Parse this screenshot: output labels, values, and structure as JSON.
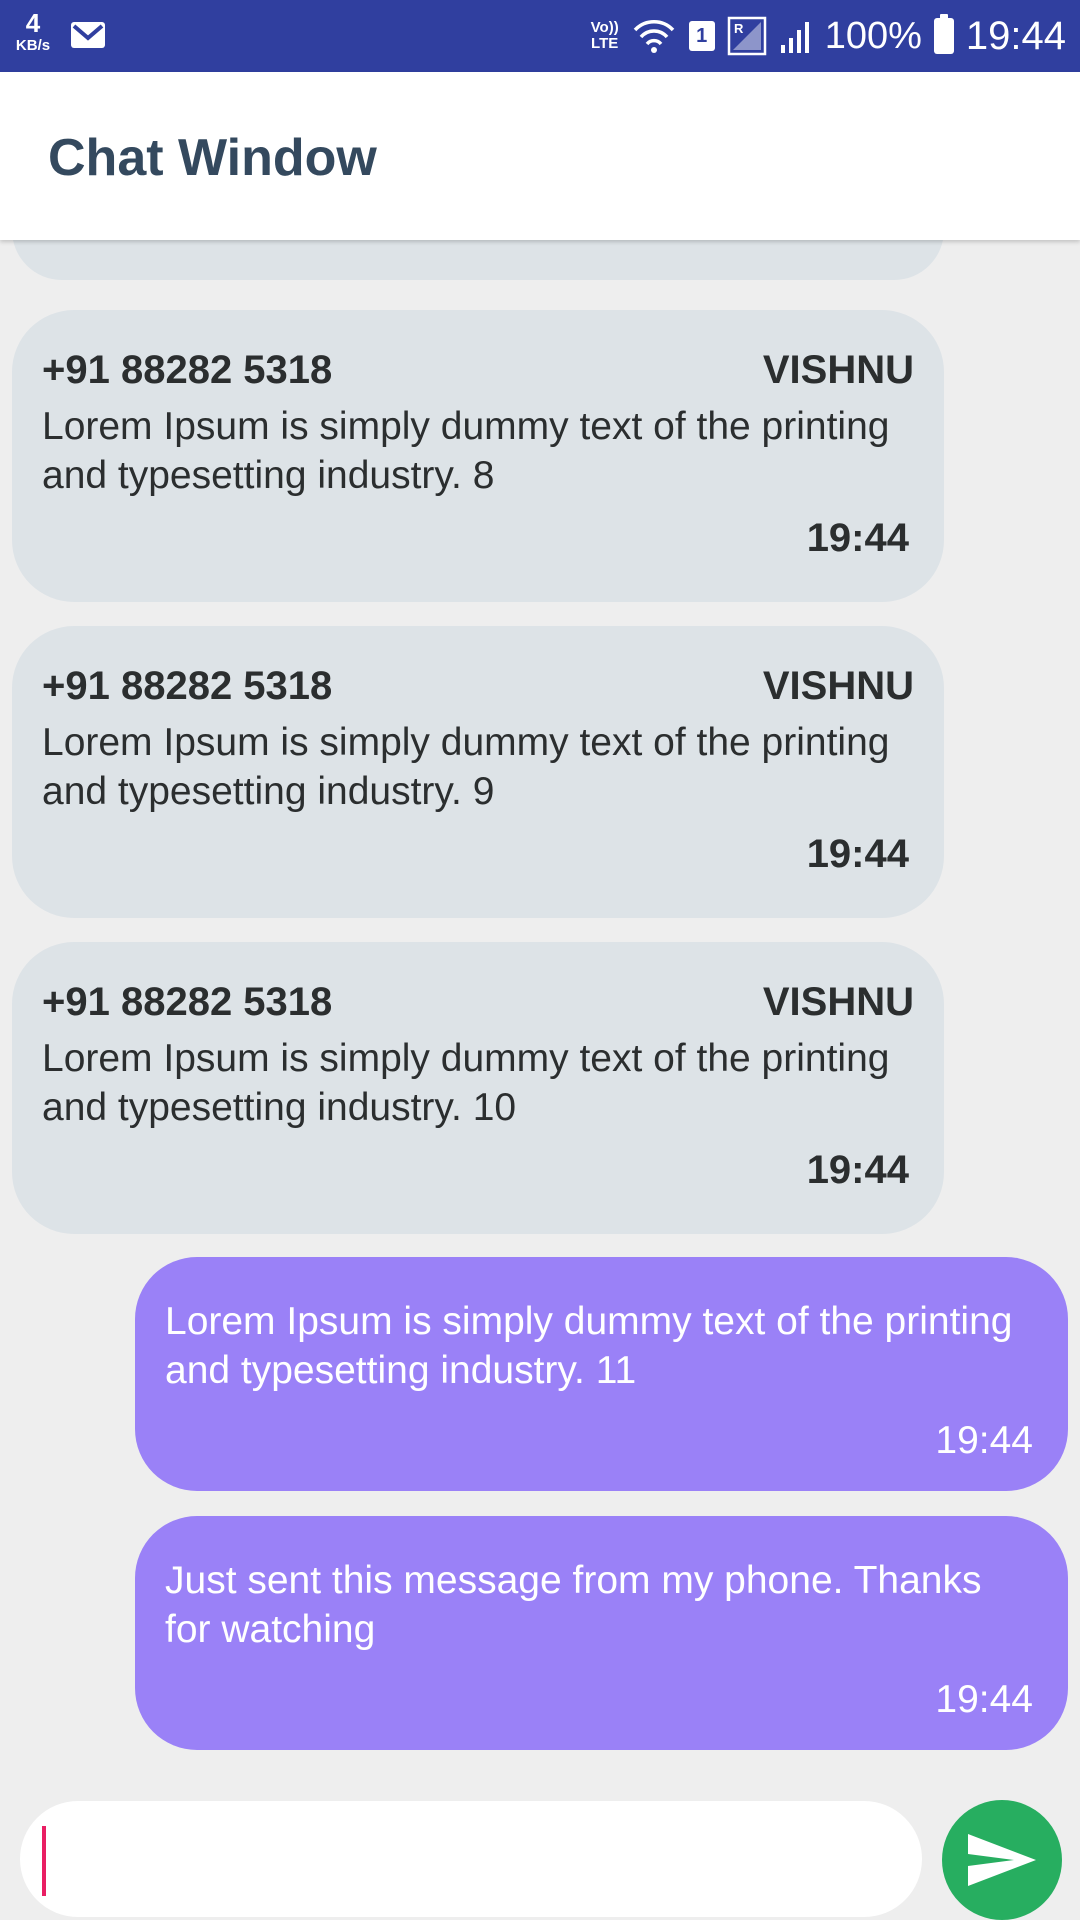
{
  "status_bar": {
    "net_speed_value": "4",
    "net_speed_unit": "KB/s",
    "volte_line1": "Vo))",
    "volte_line2": "LTE",
    "sim_slot": "1",
    "battery": "100%",
    "time": "19:44",
    "icons": [
      "gmail-icon",
      "wifi-icon",
      "roaming-signal-icon",
      "signal-icon",
      "battery-icon"
    ]
  },
  "app_bar": {
    "title": "Chat Window"
  },
  "messages": [
    {
      "direction": "incoming",
      "sender_number": "+91 88282 5318",
      "sender_name": "VISHNU",
      "text": "Lorem Ipsum is simply dummy text of the printing and typesetting industry. 8",
      "time": "19:44"
    },
    {
      "direction": "incoming",
      "sender_number": "+91 88282 5318",
      "sender_name": "VISHNU",
      "text": "Lorem Ipsum is simply dummy text of the printing and typesetting industry. 9",
      "time": "19:44"
    },
    {
      "direction": "incoming",
      "sender_number": "+91 88282 5318",
      "sender_name": "VISHNU",
      "text": "Lorem Ipsum is simply dummy text of the printing and typesetting industry. 10",
      "time": "19:44"
    },
    {
      "direction": "outgoing",
      "text": "Lorem Ipsum is simply dummy text of the printing and typesetting industry. 11",
      "time": "19:44"
    },
    {
      "direction": "outgoing",
      "text": "Just sent this message from my phone. Thanks for watching",
      "time": "19:44"
    }
  ],
  "composer": {
    "value": "",
    "placeholder": "",
    "send_icon": "send-icon"
  },
  "colors": {
    "status_bar": "#303f9f",
    "incoming_bubble": "#dde3e7",
    "outgoing_bubble": "#9a81f7",
    "send_button": "#27ae60",
    "title": "#34495e",
    "cursor": "#e91e63"
  }
}
